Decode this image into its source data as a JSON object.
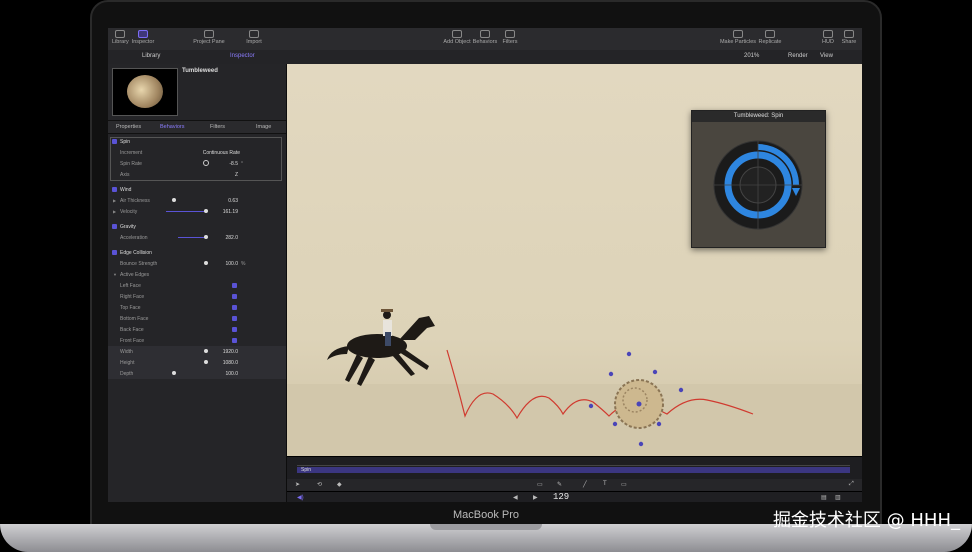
{
  "toolbar": {
    "library": "Library",
    "inspector": "Inspector",
    "project_pane": "Project Pane",
    "import": "Import",
    "add_object": "Add Object",
    "behaviors": "Behaviors",
    "filters": "Filters",
    "make_particles": "Make Particles",
    "replicate": "Replicate",
    "hud": "HUD",
    "share": "Share"
  },
  "subbar": {
    "library_tab": "Library",
    "inspector_tab": "Inspector",
    "zoom": "201%",
    "render": "Render",
    "view": "View"
  },
  "inspector": {
    "object_name": "Tumbleweed",
    "tabs": [
      "Properties",
      "Behaviors",
      "Filters",
      "Image"
    ],
    "active_tab": "Behaviors",
    "spin": {
      "header": "Spin",
      "increment_label": "Increment",
      "increment_value": "Continuous Rate",
      "spin_rate_label": "Spin Rate",
      "spin_rate_value": "-8.5",
      "spin_rate_unit": "°",
      "axis_label": "Axis",
      "axis_value": "Z"
    },
    "wind": {
      "header": "Wind",
      "air_thickness_label": "Air Thickness",
      "air_thickness_value": "0.63",
      "velocity_label": "Velocity",
      "velocity_value": "161.19"
    },
    "gravity": {
      "header": "Gravity",
      "acceleration_label": "Acceleration",
      "acceleration_value": "282.0"
    },
    "edge_collision": {
      "header": "Edge Collision",
      "bounce_label": "Bounce Strength",
      "bounce_value": "100.0",
      "bounce_unit": "%",
      "active_edges_label": "Active Edges",
      "faces": [
        "Left Face",
        "Right Face",
        "Top Face",
        "Bottom Face",
        "Back Face",
        "Front Face"
      ],
      "width_label": "Width",
      "width_value": "1920.0",
      "height_label": "Height",
      "height_value": "1080.0",
      "depth_label": "Depth",
      "depth_value": "100.0"
    }
  },
  "hud": {
    "title": "Tumbleweed: Spin"
  },
  "timeline": {
    "track_label": "Spin",
    "frame": "129"
  },
  "device": {
    "brand": "MacBook Pro"
  },
  "watermark": "掘金技术社区 @ HHH_",
  "colors": {
    "accent": "#5a53d6",
    "path": "#d03a2f",
    "hud_ring": "#2e86e0"
  }
}
